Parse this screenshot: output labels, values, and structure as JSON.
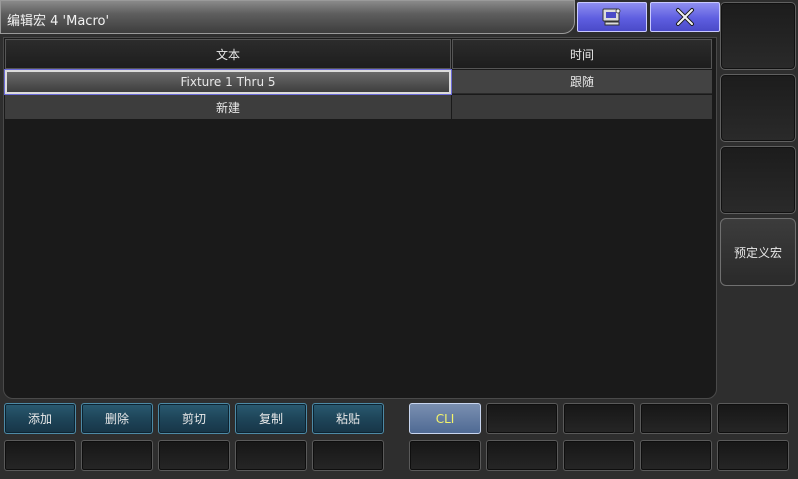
{
  "window": {
    "title": "编辑宏 4 'Macro'",
    "accent": "#6a6ae6"
  },
  "title_buttons": [
    {
      "name": "keyboard-window-button",
      "icon": "keyboard-icon"
    },
    {
      "name": "close-button",
      "icon": "close-icon"
    }
  ],
  "table": {
    "headers": [
      "文本",
      "时间"
    ],
    "rows": [
      [
        "Fixture 1 Thru 5",
        "跟随"
      ],
      [
        "新建",
        ""
      ]
    ]
  },
  "side_panel": {
    "predefined_label": "预定义宏"
  },
  "bottom_buttons": {
    "add": "添加",
    "delete": "删除",
    "cut": "剪切",
    "copy": "复制",
    "paste": "粘贴",
    "cli": "CLI"
  }
}
